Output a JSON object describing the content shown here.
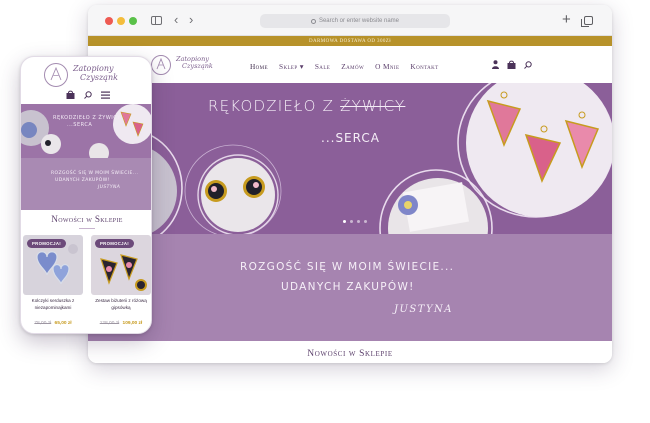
{
  "browser": {
    "url_placeholder": "Search or enter website name"
  },
  "site": {
    "top_bar": "DARMOWA DOSTAWA OD 300Zł",
    "logo": {
      "line1": "Zatopiony",
      "line2": "Czysząnk"
    },
    "nav": [
      "Home",
      "Sklep ▾",
      "Sale",
      "Zamów",
      "O Mnie",
      "Kontakt"
    ],
    "header_icons": [
      "user-icon",
      "bag-icon",
      "search-icon"
    ],
    "hero": {
      "title_start": "RĘKODZIEŁO Z",
      "title_struck": "ŻYWICY",
      "subtitle": "...SERCA"
    },
    "quote": {
      "line1": "ROZGOŚĆ SIĘ W MOIM ŚWIECIE...",
      "line2": "UDANYCH ZAKUPÓW!",
      "signature": "JUSTYNA"
    },
    "section_heading": "Nowości w Sklepie"
  },
  "phone": {
    "logo": {
      "line1": "Zatopiony",
      "line2": "Czysząnk"
    },
    "hero": {
      "line1": "RĘKODZIEŁO Z ŻYWICY",
      "line2": "...SERCA"
    },
    "quote": {
      "line1": "ROZGOŚĆ SIĘ W MOIM ŚWIECIE...",
      "line2": "UDANYCH ZAKUPÓW!",
      "line3": "JUSTYNA"
    },
    "section_heading": "Nowości w Sklepie",
    "products": [
      {
        "badge": "PROMOCJA!",
        "name": "Kolczyki serduszka z niezapominajkami",
        "old_price": "78,00 zł",
        "new_price": "65,00 zł"
      },
      {
        "badge": "PROMOCJA!",
        "name": "Zestaw biżuterii z różową gipsówką",
        "old_price": "128,00 zł",
        "new_price": "109,00 zł"
      }
    ]
  },
  "colors": {
    "brand_purple": "#8b5f99",
    "band_purple": "#a684b0",
    "gold": "#b7922a",
    "price_gold": "#c79b1f"
  }
}
